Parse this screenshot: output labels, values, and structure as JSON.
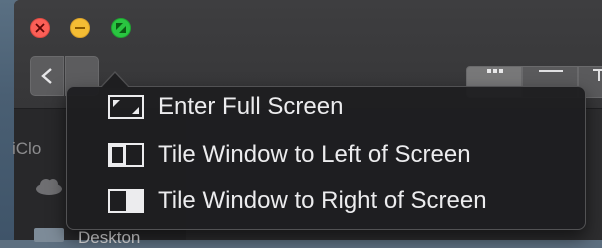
{
  "window": {
    "traffic_lights": {
      "close": {
        "icon": "close-icon",
        "color": "#fb5f57"
      },
      "minimize": {
        "icon": "minimize-icon",
        "color": "#f4bd34"
      },
      "zoom": {
        "icon": "fullscreen-arrows-icon",
        "color": "#2ac541"
      }
    },
    "toolbar": {
      "back_icon": "chevron-left-icon",
      "view_buttons": [
        "icon-view-icon",
        "list-view-icon",
        "column-view-icon"
      ]
    }
  },
  "sidebar": {
    "section_label": "iClo",
    "visible_item_label": "Deskton"
  },
  "zoom_menu": {
    "items": [
      {
        "label": "Enter Full Screen",
        "icon": "full-screen-icon"
      },
      {
        "label": "Tile Window to Left of Screen",
        "icon": "tile-left-icon"
      },
      {
        "label": "Tile Window to Right of Screen",
        "icon": "tile-right-icon"
      }
    ]
  },
  "colors": {
    "menu_background": "#1e1e20",
    "menu_text": "#ececee",
    "window_chrome": "#3e3e40"
  }
}
